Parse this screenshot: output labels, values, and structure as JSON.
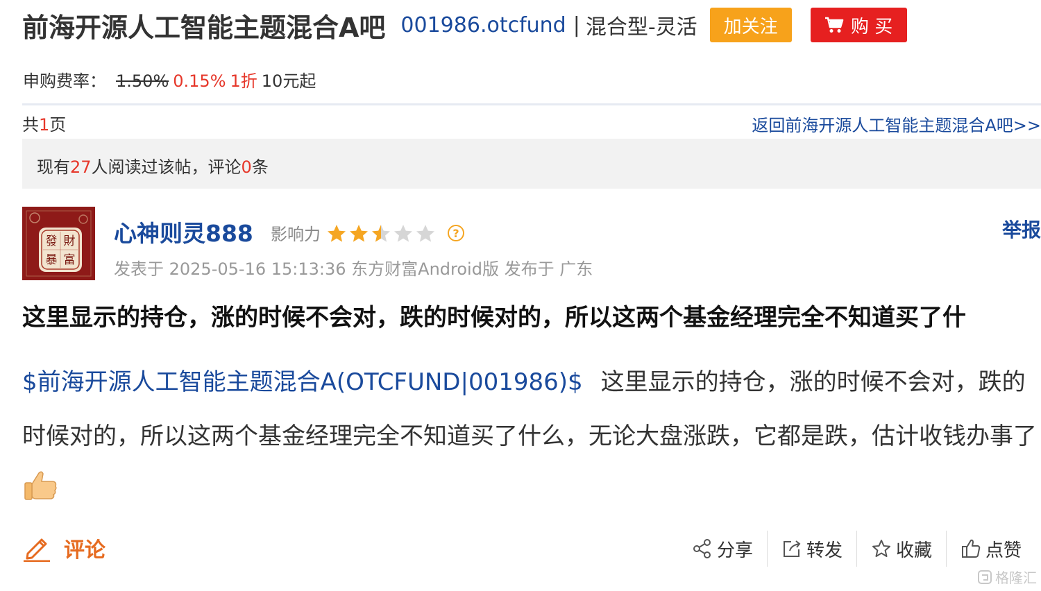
{
  "header": {
    "bar_title": "前海开源人工智能主题混合A吧",
    "fund_code": "001986.otcfund",
    "separator": "|",
    "fund_type": "混合型-灵活",
    "follow_label": "加关注",
    "buy_label": "购 买"
  },
  "fee": {
    "label": "申购费率：",
    "old_rate": "1.50%",
    "new_rate": "0.15%",
    "discount": "1折",
    "minimum": "10元起"
  },
  "pagination": {
    "prefix": "共",
    "count": "1",
    "suffix": "页",
    "back_link": "返回前海开源人工智能主题混合A吧>>"
  },
  "stats": {
    "prefix": "现有",
    "readers": "27",
    "middle": "人阅读过该帖，评论",
    "comments": "0",
    "suffix": "条"
  },
  "author": {
    "name": "心神则灵888",
    "influence_label": "影响力",
    "rating": 2.5,
    "rating_max": 5,
    "report_label": "举报",
    "meta": "发表于 2025-05-16 15:13:36 东方财富Android版 发布于 广东",
    "avatar_text": "發財暴富"
  },
  "post": {
    "title": "这里显示的持仓，涨的时候不会对，跌的时候对的，所以这两个基金经理完全不知道买了什",
    "stock_tag": "$前海开源人工智能主题混合A(OTCFUND|001986)$",
    "body": "这里显示的持仓，涨的时候不会对，跌的时候对的，所以这两个基金经理完全不知道买了什么，无论大盘涨跌，它都是跌，估计收钱办事了",
    "emoji_icon": "thumbs-up-emoji"
  },
  "footer": {
    "comment_label": "评论",
    "share_label": "分享",
    "forward_label": "转发",
    "favorite_label": "收藏",
    "like_label": "点赞",
    "watermark": "格隆汇"
  },
  "colors": {
    "link_blue": "#1a4a9c",
    "accent_red": "#e6372a",
    "follow_orange": "#f7a21b",
    "buy_red": "#e62020",
    "star_orange": "#f5a623",
    "comment_orange": "#e66b20"
  }
}
